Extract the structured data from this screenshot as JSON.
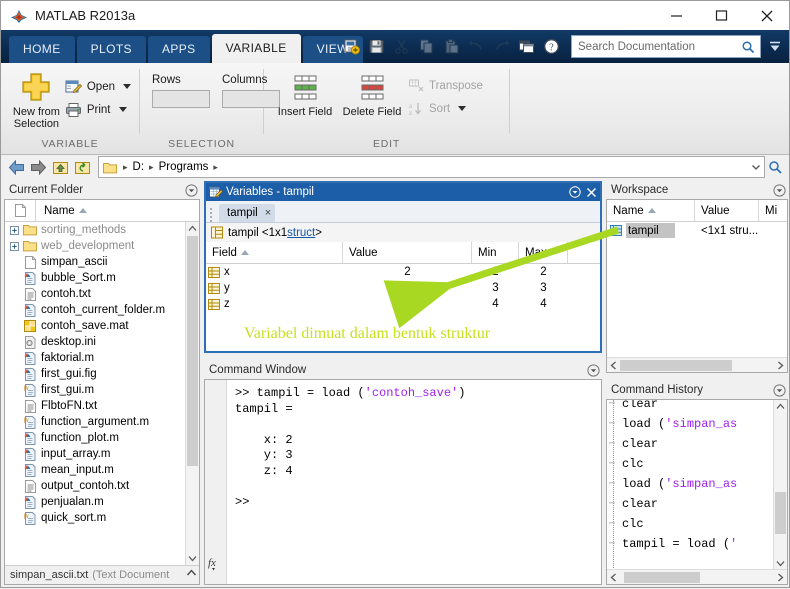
{
  "window": {
    "title": "MATLAB R2013a",
    "icon": "matlab-logo-icon",
    "minimize": "minimize-icon",
    "maximize": "maximize-icon",
    "close": "close-icon"
  },
  "ribbon_tabs": [
    {
      "label": "HOME",
      "active": false
    },
    {
      "label": "PLOTS",
      "active": false
    },
    {
      "label": "APPS",
      "active": false
    },
    {
      "label": "VARIABLE",
      "active": true
    },
    {
      "label": "VIEW",
      "active": false
    }
  ],
  "quick_access": [
    {
      "name": "new-script-icon",
      "enabled": true
    },
    {
      "name": "save-icon",
      "enabled": true
    },
    {
      "name": "cut-icon",
      "enabled": false
    },
    {
      "name": "copy-icon",
      "enabled": false
    },
    {
      "name": "paste-icon",
      "enabled": false
    },
    {
      "name": "undo-icon",
      "enabled": false
    },
    {
      "name": "redo-icon",
      "enabled": false
    },
    {
      "name": "switch-window-icon",
      "enabled": true
    },
    {
      "name": "help-icon",
      "enabled": true
    }
  ],
  "search": {
    "placeholder": "Search Documentation",
    "value": "",
    "icon": "search-icon"
  },
  "ribbon": {
    "groups": [
      {
        "label": "VARIABLE",
        "new_from_selection": "New from Selection",
        "open": "Open",
        "print": "Print"
      },
      {
        "label": "SELECTION",
        "rows_label": "Rows",
        "rows_value": "",
        "columns_label": "Columns",
        "columns_value": ""
      },
      {
        "label": "EDIT",
        "insert_field": "Insert Field",
        "delete_field": "Delete Field",
        "transpose": "Transpose",
        "sort": "Sort"
      }
    ]
  },
  "address_bar": {
    "back": "back-arrow-icon",
    "forward": "forward-arrow-icon",
    "up": "up-folder-icon",
    "refresh": "refresh-icon",
    "crumbs": [
      "D:",
      "Programs"
    ],
    "browse": "browse-icon"
  },
  "current_folder": {
    "title": "Current Folder",
    "column_name": "Name",
    "files": [
      {
        "name": "sorting_methods",
        "type": "folder",
        "expandable": true
      },
      {
        "name": "web_development",
        "type": "folder",
        "expandable": true
      },
      {
        "name": "simpan_ascii",
        "type": "blank",
        "expandable": false
      },
      {
        "name": "bubble_Sort.m",
        "type": "mfile",
        "expandable": false
      },
      {
        "name": "contoh.txt",
        "type": "txt",
        "expandable": false
      },
      {
        "name": "contoh_current_folder.m",
        "type": "mfile",
        "expandable": false
      },
      {
        "name": "contoh_save.mat",
        "type": "mat",
        "expandable": false
      },
      {
        "name": "desktop.ini",
        "type": "ini",
        "expandable": false
      },
      {
        "name": "faktorial.m",
        "type": "mfile",
        "expandable": false
      },
      {
        "name": "first_gui.fig",
        "type": "mfile",
        "expandable": false
      },
      {
        "name": "first_gui.m",
        "type": "fx",
        "expandable": false
      },
      {
        "name": "FlbtoFN.txt",
        "type": "txt",
        "expandable": false
      },
      {
        "name": "function_argument.m",
        "type": "fx",
        "expandable": false
      },
      {
        "name": "function_plot.m",
        "type": "mfile",
        "expandable": false
      },
      {
        "name": "input_array.m",
        "type": "mfile",
        "expandable": false
      },
      {
        "name": "mean_input.m",
        "type": "mfile",
        "expandable": false
      },
      {
        "name": "output_contoh.txt",
        "type": "txt",
        "expandable": false
      },
      {
        "name": "penjualan.m",
        "type": "mfile",
        "expandable": false
      },
      {
        "name": "quick_sort.m",
        "type": "fx",
        "expandable": false
      }
    ],
    "status_name": "simpan_ascii.txt",
    "status_type": "(Text Document"
  },
  "variables_panel": {
    "title": "Variables - tampil",
    "tab_label": "tampil",
    "tab_close": "close-icon",
    "breadcrumb_name": "tampil <1x1 ",
    "breadcrumb_link": "struct",
    "breadcrumb_tail": ">",
    "columns": [
      "Field",
      "Value",
      "Min",
      "Max"
    ],
    "rows": [
      {
        "field": "x",
        "value": "2",
        "min": "2",
        "max": "2"
      },
      {
        "field": "y",
        "value": "3",
        "min": "3",
        "max": "3"
      },
      {
        "field": "z",
        "value": "4",
        "min": "4",
        "max": "4"
      }
    ]
  },
  "command_window": {
    "title": "Command Window",
    "prompt": ">>",
    "command_head": ">> tampil = load (",
    "command_string": "'contoh_save'",
    "command_tail": ")",
    "output": "tampil =\n\n    x: 2\n    y: 3\n    z: 4",
    "final_prompt": ">>"
  },
  "workspace": {
    "title": "Workspace",
    "columns": [
      "Name",
      "Value",
      "Mi"
    ],
    "rows": [
      {
        "name": "tampil",
        "value": "<1x1 stru...",
        "selected": true
      }
    ]
  },
  "command_history": {
    "title": "Command History",
    "entries": [
      {
        "head": "clear",
        "string": "",
        "tail": ""
      },
      {
        "head": "load (",
        "string": "'simpan_as",
        "tail": ""
      },
      {
        "head": "clear",
        "string": "",
        "tail": ""
      },
      {
        "head": "clc",
        "string": "",
        "tail": ""
      },
      {
        "head": "load (",
        "string": "'simpan_as",
        "tail": ""
      },
      {
        "head": "clear",
        "string": "",
        "tail": ""
      },
      {
        "head": "clc",
        "string": "",
        "tail": ""
      },
      {
        "head": "tampil = load (",
        "string": "'",
        "tail": ""
      }
    ]
  },
  "annotation": {
    "text": "Variabel dimuat dalam bentuk struktur",
    "color": "#c7e021",
    "arrow": "green-arrow"
  },
  "colors": {
    "ribbon_dark": "#0c2d53",
    "panel_title_active": "#1d5ea8",
    "string_purple": "#a020f0",
    "link_blue": "#1656a8"
  }
}
